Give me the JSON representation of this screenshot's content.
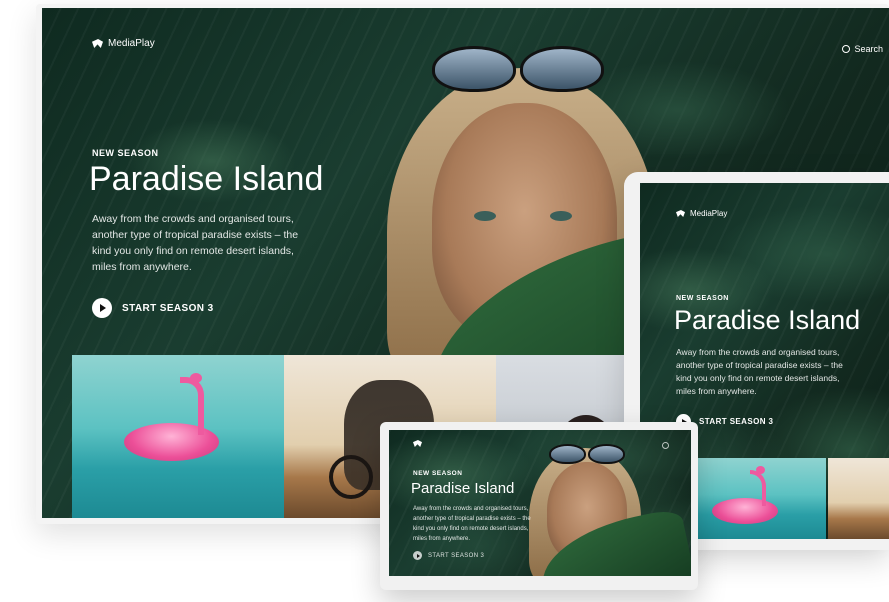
{
  "brand": {
    "name": "MediaPlay"
  },
  "search": {
    "label": "Search"
  },
  "hero": {
    "eyebrow": "NEW SEASON",
    "title": "Paradise Island",
    "description": "Away from the crowds and organised tours, another type of tropical paradise exists – the kind you only find on remote desert islands, miles from anywhere.",
    "cta": "START SEASON 3"
  },
  "thumbnails": [
    {
      "icon": "flamingo-float-thumbnail"
    },
    {
      "icon": "motorbike-rider-thumbnail"
    },
    {
      "icon": "portrait-thumbnail"
    }
  ],
  "colors": {
    "background": "#ffffff",
    "foliage": "#1a3d30",
    "text": "#ffffff",
    "accent_pink": "#ec4f98",
    "water": "#5cc2c2"
  },
  "icons": {
    "logo": "mediaplay-logo-icon",
    "search": "search-icon",
    "play": "play-icon"
  }
}
